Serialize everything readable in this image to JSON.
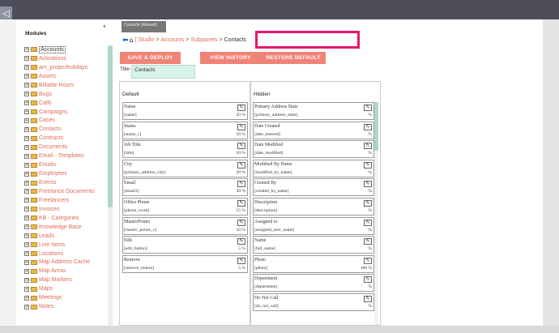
{
  "modules_panel": {
    "title": "Modules",
    "collapse_icon": "chevron-left",
    "items": [
      {
        "label": "Accounts",
        "selected": true
      },
      {
        "label": "Activations"
      },
      {
        "label": "am_projectholidays"
      },
      {
        "label": "Assets"
      },
      {
        "label": "Billable Hours"
      },
      {
        "label": "Bugs"
      },
      {
        "label": "Calls"
      },
      {
        "label": "Campaigns"
      },
      {
        "label": "Cases"
      },
      {
        "label": "Contacts"
      },
      {
        "label": "Contracts"
      },
      {
        "label": "Documents"
      },
      {
        "label": "Email - Templates"
      },
      {
        "label": "Emails"
      },
      {
        "label": "Employees"
      },
      {
        "label": "Events"
      },
      {
        "label": "Freelance Documents"
      },
      {
        "label": "Freelancers"
      },
      {
        "label": "Invoices"
      },
      {
        "label": "KB - Categories"
      },
      {
        "label": "Knowledge Base"
      },
      {
        "label": "Leads"
      },
      {
        "label": "Line Items"
      },
      {
        "label": "Locations"
      },
      {
        "label": "Map Address Cache"
      },
      {
        "label": "Map Areas"
      },
      {
        "label": "Map Markers"
      },
      {
        "label": "Maps"
      },
      {
        "label": "Meetings"
      },
      {
        "label": "Notes"
      }
    ]
  },
  "studio": {
    "tab_label": "Contacts (Aliased)",
    "breadcrumb": {
      "back_icon": "back-arrow",
      "home_icon": "home",
      "links": [
        "[ Studio",
        "Accounts",
        "Subpanels"
      ],
      "separator": ">",
      "current": "Contacts"
    },
    "buttons": {
      "save_deploy": "SAVE & DEPLOY",
      "view_history": "VIEW HISTORY",
      "restore_default": "RESTORE DEFAULT"
    },
    "title_label": "Title",
    "title_value": "Contacts",
    "default_column": {
      "header": "Default",
      "fields": [
        {
          "label": "Name",
          "name": "[name]",
          "width": "43 %"
        },
        {
          "label": "Status",
          "name": "[status_c]",
          "width": "10 %"
        },
        {
          "label": "Job Title",
          "name": "[title]",
          "width": "10 %"
        },
        {
          "label": "City",
          "name": "[primary_address_city]",
          "width": "20 %"
        },
        {
          "label": "Email",
          "name": "[email1]",
          "width": "30 %"
        },
        {
          "label": "Office Phone",
          "name": "[phone_work]",
          "width": "15 %"
        },
        {
          "label": "MauticPoints",
          "name": "[mautic_points_c]",
          "width": "10 %"
        },
        {
          "label": "Edit",
          "name": "[edit_button]",
          "width": "5 %"
        },
        {
          "label": "Remove",
          "name": "[remove_button]",
          "width": "5 %"
        }
      ]
    },
    "hidden_column": {
      "header": "Hidden",
      "fields": [
        {
          "label": "Primary Address State",
          "name": "[primary_address_state]",
          "width": "%"
        },
        {
          "label": "Date Created",
          "name": "[date_entered]",
          "width": "%"
        },
        {
          "label": "Date Modified",
          "name": "[date_modified]",
          "width": "%"
        },
        {
          "label": "Modified By Name",
          "name": "[modified_by_name]",
          "width": "%"
        },
        {
          "label": "Created By",
          "name": "[created_by_name]",
          "width": "%"
        },
        {
          "label": "Description",
          "name": "[description]",
          "width": "%"
        },
        {
          "label": "Assigned to",
          "name": "[assigned_user_name]",
          "width": "%"
        },
        {
          "label": "Name",
          "name": "[full_name]",
          "width": "%"
        },
        {
          "label": "Photo",
          "name": "[photo]",
          "width": "160 %"
        },
        {
          "label": "Department",
          "name": "[department]",
          "width": "%"
        },
        {
          "label": "Do Not Call",
          "name": "[do_not_call]",
          "width": "%"
        }
      ]
    }
  },
  "colors": {
    "accent_button": "#f08377",
    "link": "#e06b58",
    "highlight_box": "#e8166e",
    "scroll_thumb": "#a9d8c9"
  }
}
